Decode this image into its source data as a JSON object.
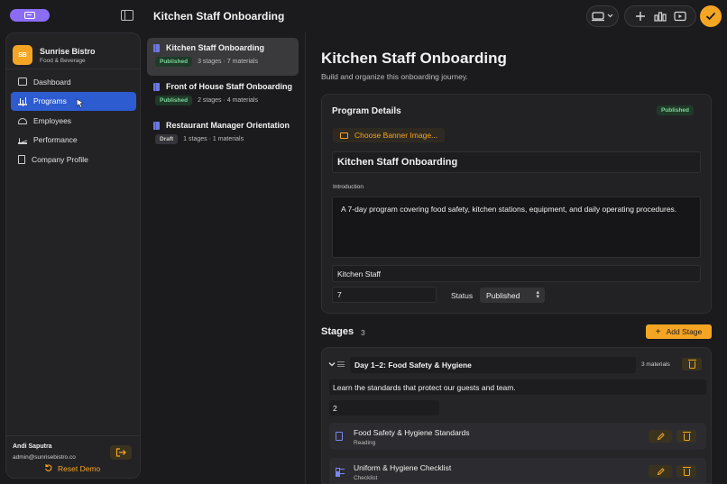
{
  "header": {
    "title": "Kitchen Staff Onboarding"
  },
  "sidebar": {
    "company": {
      "initials": "SB",
      "name": "Sunrise Bistro",
      "industry": "Food & Beverage"
    },
    "items": [
      {
        "label": "Dashboard",
        "active": false
      },
      {
        "label": "Programs",
        "active": true
      },
      {
        "label": "Employees",
        "active": false
      },
      {
        "label": "Performance",
        "active": false
      },
      {
        "label": "Company Profile",
        "active": false
      }
    ],
    "user": {
      "name": "Andi Saputra",
      "email": "admin@sunrisebistro.co"
    },
    "reset_label": "Reset Demo"
  },
  "programs": [
    {
      "title": "Kitchen Staff Onboarding",
      "status": "Published",
      "meta": "3 stages · 7 materials",
      "selected": true
    },
    {
      "title": "Front of House Staff Onboarding",
      "status": "Published",
      "meta": "2 stages · 4 materials",
      "selected": false
    },
    {
      "title": "Restaurant Manager Orientation",
      "status": "Draft",
      "meta": "1 stages · 1 materials",
      "selected": false
    }
  ],
  "main": {
    "title": "Kitchen Staff Onboarding",
    "subtitle": "Build and organize this onboarding journey.",
    "details": {
      "heading": "Program Details",
      "status_badge": "Published",
      "banner_button": "Choose Banner Image...",
      "program_title": "Kitchen Staff Onboarding",
      "intro_label": "Introduction",
      "intro_text": "A 7-day program covering food safety, kitchen stations, equipment, and daily operating procedures.",
      "audience": "Kitchen Staff",
      "duration": "7",
      "status_label": "Status",
      "status_value": "Published"
    },
    "stages": {
      "heading": "Stages",
      "count": "3",
      "add_label": "Add Stage",
      "items": [
        {
          "name": "Day 1–2: Food Safety & Hygiene",
          "materials_count": "3 materials",
          "description": "Learn the standards that protect our guests and team.",
          "days": "2",
          "materials": [
            {
              "title": "Food Safety & Hygiene Standards",
              "type": "Reading",
              "icon": "document-icon"
            },
            {
              "title": "Uniform & Hygiene Checklist",
              "type": "Checklist",
              "icon": "checklist-icon"
            }
          ]
        }
      ]
    }
  },
  "colors": {
    "accent": "#f5a524",
    "active_nav": "#2d5bd0",
    "brand": "#8a6cf5",
    "published": "#7ed69a"
  }
}
